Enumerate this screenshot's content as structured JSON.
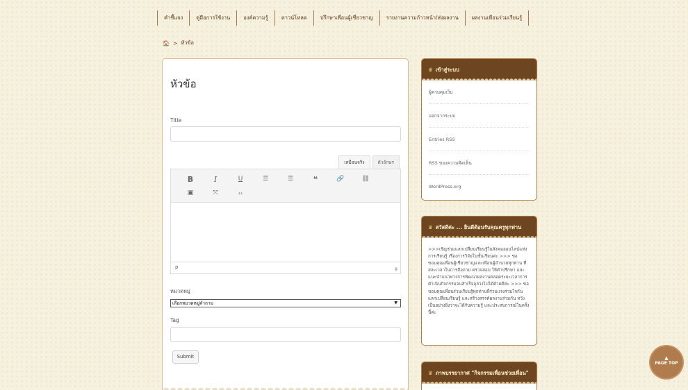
{
  "topnav": {
    "items": [
      "คำชี้แจง",
      "คู่มือการใช้งาน",
      "องค์ความรู้",
      "ดาวน์โหลด",
      "ปรึกษาเพื่อนผู้เชี่ยวชาญ",
      "รายงานความก้าวหน้า/ส่งผลงาน",
      "ผลงานเพื่อนร่วมเรียนรู้"
    ]
  },
  "breadcrumb": {
    "home_icon": "home-icon",
    "separator": ">",
    "current": "หัวข้อ"
  },
  "form": {
    "page_title": "หัวข้อ",
    "title_label": "Title",
    "title_value": "",
    "tabs": [
      "เสมือนจริง",
      "ตัวอักษร"
    ],
    "toolbar_row1": [
      "B",
      "I",
      "U",
      "☰",
      "☰",
      "❝",
      "🔗",
      "⛓"
    ],
    "toolbar_row2": [
      "▣",
      "⤧",
      "‹›"
    ],
    "editor_path": "p",
    "category_label": "หมวดหมู่",
    "category_selected": "เลือกหมวดหมู่คำถาม",
    "tag_label": "Tag",
    "tag_value": "",
    "submit_label": "Submit"
  },
  "sidebar": {
    "login": {
      "title": "เข้าสู่ระบบ",
      "links": [
        "ผู้ควบคุมเว็บ",
        "ออกจากระบบ",
        "Entries RSS",
        "RSS ของความคิดเห็น",
        "WordPress.org"
      ]
    },
    "welcome": {
      "title": "สวัสดีค่ะ ... ยินดีต้อนรับคุณครูทุกท่าน",
      "text": ">>>เชิญร่วมแลกเปลี่ยนเรียนรู้ในสังคมออนไลน์แห่งการเรียนรู้ เรื่องการวิจัยในชั้นเรียนค่ะ >>> ขอขอบคุณเพื่อนผู้เชี่ยวชาญและเพื่อนผู้อำนวยทุกท่าน ที่สละเวลาในการถือถาม ตรวจสอบ ให้คำปรึกษา และแนะนำแนวทางการพัฒนาผลงานตลอดระยะเวลาการดำเนินกิจกรรมจนสำเร็จลุล่วงไปได้ด้วยดีค่ะ >>> ขอขอบคุณเพื่อนร่วมเรียนรู้ทุกท่านที่ร่วมแรงร่วมใจกันแลกเปลี่ยนเรียนรู้ และสร้างสรรค์ผลงานร่วมกัน หวังเป็นอย่างยิ่งว่าจะได้รับความรู้ และประสบการณ์ในครั้งนี้ค่ะ"
    },
    "gallery": {
      "title": "ภาพบรรยากาศ \"กิจกรรมเพื่อนช่วยเพื่อน\""
    }
  },
  "pagetop": {
    "label": "PAGE TOP"
  }
}
